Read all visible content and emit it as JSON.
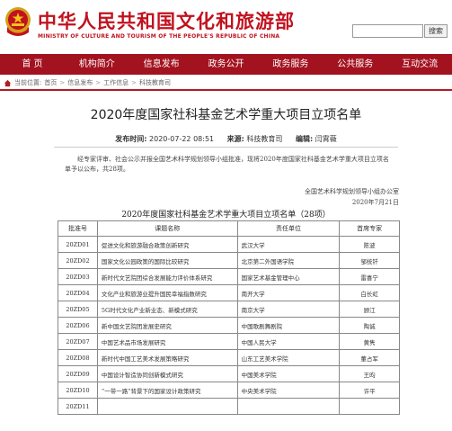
{
  "header": {
    "site_title": "中华人民共和国文化和旅游部",
    "site_subtitle": "MINISTRY OF CULTURE AND TOURISM OF THE PEOPLE'S REPUBLIC OF CHINA",
    "search_placeholder": "",
    "search_button": "搜索",
    "emblem_icon": "national-emblem-icon"
  },
  "nav": {
    "items": [
      "首 页",
      "机构简介",
      "信息发布",
      "政务公开",
      "政务服务",
      "公共服务",
      "互动交流"
    ]
  },
  "breadcrumb": {
    "label": "当前位置:",
    "items": [
      "首页",
      "信息发布",
      "工作信息",
      "科技教育司"
    ],
    "separator": ">"
  },
  "article": {
    "title": "2020年度国家社科基金艺术学重大项目立项名单",
    "publish_label": "发布时间:",
    "publish_time": "2020-07-22 08:51",
    "source_label": "来源:",
    "source": "科技教育司",
    "editor_label": "编辑:",
    "editor": "闫霄薇",
    "paragraph": "经专家评审、社会公示并报全国艺术科学规划领导小组批准，现将2020年度国家社科基金艺术学重大项目立项名单予以公布，共28项。",
    "signature_org": "全国艺术科学规划领导小组办公室",
    "signature_date": "2020年7月21日"
  },
  "table": {
    "title": "2020年度国家社科基金艺术学重大项目立项名单（28项）",
    "headers": [
      "批准号",
      "课题名称",
      "责任单位",
      "首席专家"
    ],
    "rows": [
      [
        "20ZD01",
        "促进文化和旅游融合政策创新研究",
        "武汉大学",
        "陈波"
      ],
      [
        "20ZD02",
        "国家文化公园政策的国际比较研究",
        "北京第二外国语学院",
        "邹统钎"
      ],
      [
        "20ZD03",
        "新时代文艺院团综合发展能力评价体系研究",
        "国家艺术基金管理中心",
        "雷喜宁"
      ],
      [
        "20ZD04",
        "文化产业和旅游业提升国民幸福指数研究",
        "南开大学",
        "白长虹"
      ],
      [
        "20ZD05",
        "5G时代文化产业新业态、新模式研究",
        "南京大学",
        "顾江"
      ],
      [
        "20ZD06",
        "新中国文艺院团发展史研究",
        "中国歌剧舞剧院",
        "陶诚"
      ],
      [
        "20ZD07",
        "中国艺术品市场发展研究",
        "中国人民大学",
        "黄隽"
      ],
      [
        "20ZD08",
        "新时代中国工艺美术发展策略研究",
        "山东工艺美术学院",
        "董占军"
      ],
      [
        "20ZD09",
        "中国设计智造协同创新模式研究",
        "中国美术学院",
        "王昀"
      ],
      [
        "20ZD10",
        "“一带一路”背景下的国家设计政策研究",
        "中央美术学院",
        "许平"
      ],
      [
        "20ZD11",
        "",
        "",
        ""
      ]
    ]
  }
}
